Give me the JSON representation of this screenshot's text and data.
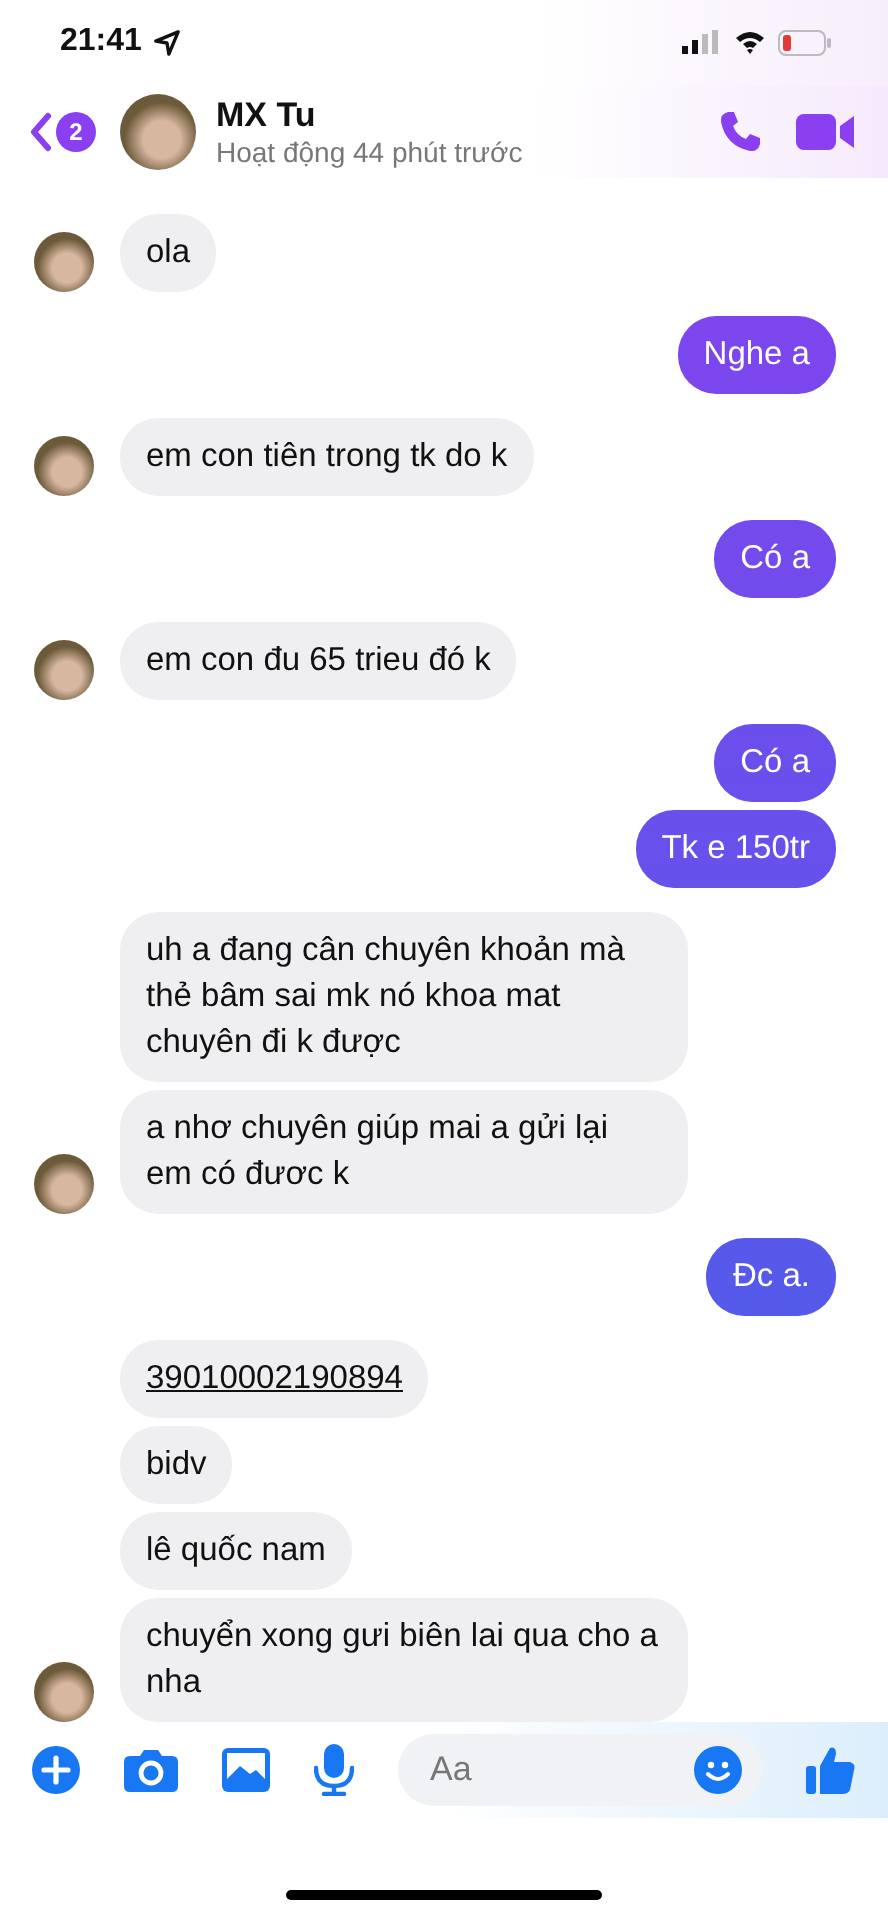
{
  "status_bar": {
    "time": "21:41"
  },
  "header": {
    "back_badge": "2",
    "name": "MX Tu",
    "status": "Hoạt động 44 phút trước"
  },
  "groups": [
    {
      "kind": "incoming",
      "messages": [
        {
          "kind": "text",
          "text": "ola"
        }
      ]
    },
    {
      "kind": "outgoing",
      "messages": [
        {
          "kind": "text",
          "text": "Nghe a"
        }
      ]
    },
    {
      "kind": "incoming",
      "messages": [
        {
          "kind": "text",
          "text": "em con tiên trong tk do k"
        }
      ]
    },
    {
      "kind": "outgoing",
      "messages": [
        {
          "kind": "text",
          "text": "Có a"
        }
      ]
    },
    {
      "kind": "incoming",
      "messages": [
        {
          "kind": "text",
          "text": "em con đu 65 trieu đó k"
        }
      ]
    },
    {
      "kind": "outgoing",
      "messages": [
        {
          "kind": "text",
          "text": "Có a"
        },
        {
          "kind": "text",
          "text": "Tk e 150tr"
        }
      ]
    },
    {
      "kind": "incoming",
      "messages": [
        {
          "kind": "text",
          "text": "uh a đang cân chuyên khoản mà thẻ bâm sai mk nó khoa mat chuyên đi k được"
        },
        {
          "kind": "text",
          "text": "a nhơ chuyên giúp mai a gửi lại em có đươc k"
        }
      ]
    },
    {
      "kind": "outgoing",
      "messages": [
        {
          "kind": "text",
          "text": "Đc a."
        }
      ]
    },
    {
      "kind": "incoming",
      "messages": [
        {
          "kind": "link",
          "text": "39010002190894"
        },
        {
          "kind": "text",
          "text": "bidv"
        },
        {
          "kind": "text",
          "text": "lê quốc nam"
        },
        {
          "kind": "text",
          "text": "chuyển xong gưi biên lai qua cho a nha"
        }
      ]
    }
  ],
  "composer": {
    "placeholder": "Aa"
  }
}
